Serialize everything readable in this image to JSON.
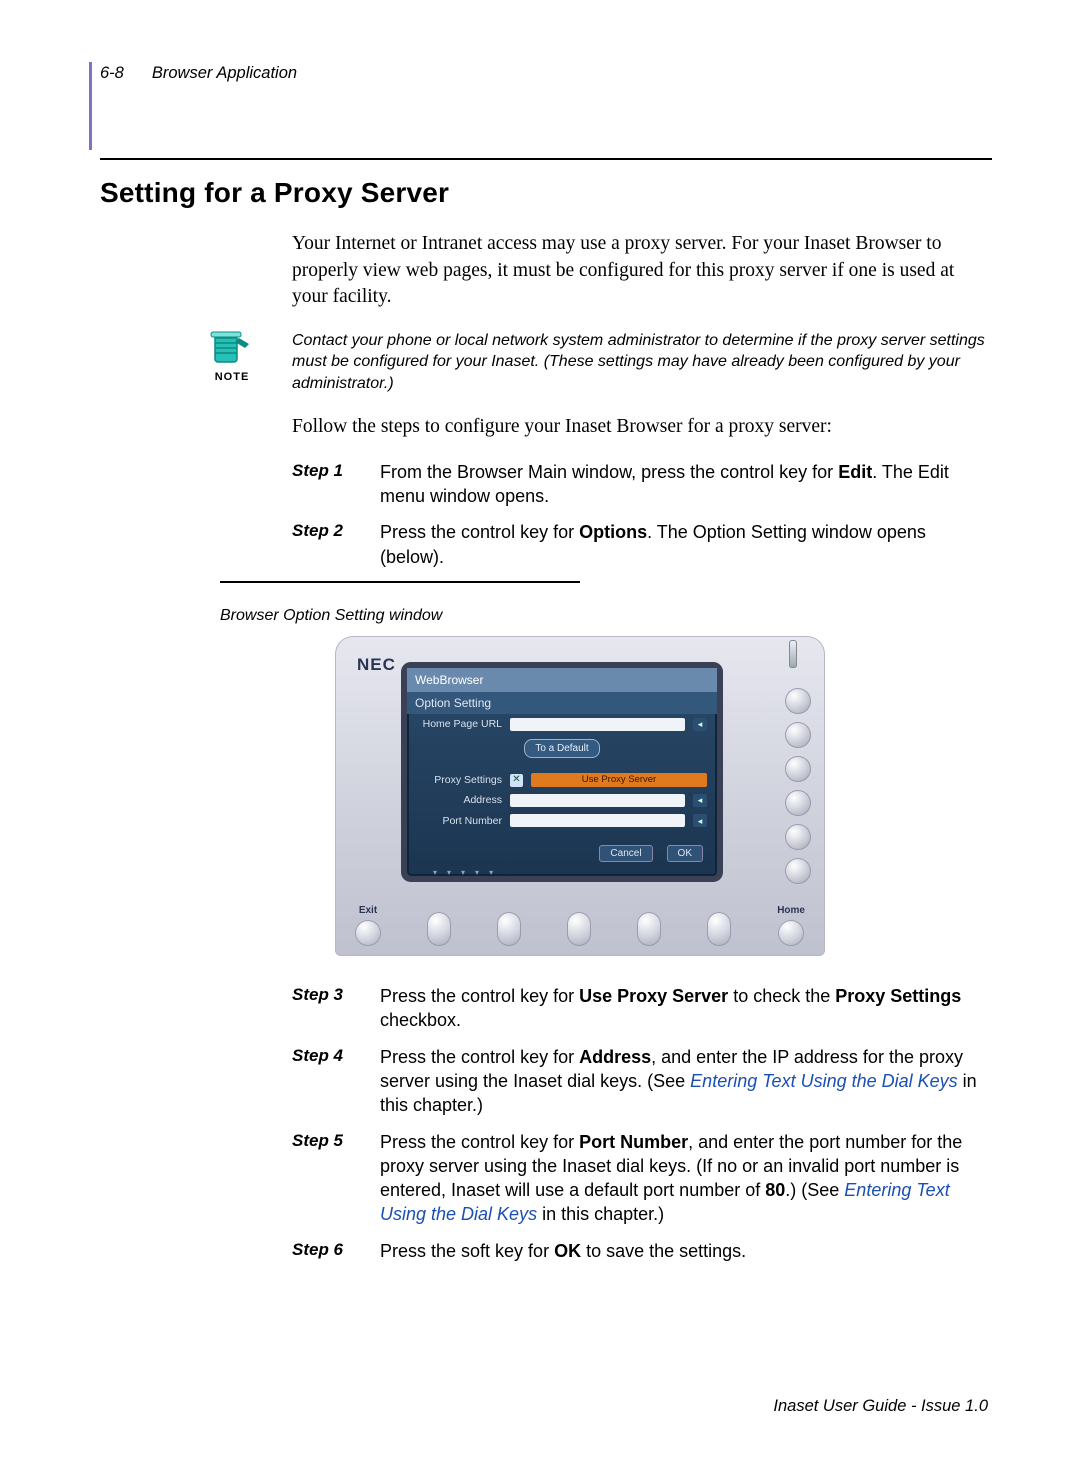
{
  "header": {
    "page_num": "6-8",
    "section": "Browser Application"
  },
  "title": "Setting for a Proxy Server",
  "intro": "Your Internet or Intranet access may use a proxy server. For your Inaset Browser to properly view web pages, it must be configured for this proxy server if one is used at your facility.",
  "note": {
    "label": "NOTE",
    "text": "Contact your phone or local network system administrator to determine if the proxy server settings must be configured for your Inaset. (These settings may have already been configured by your administrator.)"
  },
  "lead": "Follow the steps to configure your Inaset Browser for a proxy server:",
  "steps_top": [
    {
      "k": "Step  1",
      "pre": "From the Browser Main window, press the control key for ",
      "b": "Edit",
      "post": ". The Edit menu window opens."
    },
    {
      "k": "Step  2",
      "pre": "Press the control key for ",
      "b": "Options",
      "post": ". The Option Setting window opens (below)."
    }
  ],
  "figure": {
    "caption": "Browser Option Setting window",
    "nec": "NEC",
    "lcd": {
      "title": "WebBrowser",
      "subtitle": "Option Setting",
      "home_label": "Home Page URL",
      "to_default": "To a Default",
      "proxy_label": "Proxy Settings",
      "use_proxy": "Use Proxy Server",
      "address_label": "Address",
      "port_label": "Port Number",
      "cancel": "Cancel",
      "ok": "OK"
    },
    "hw": {
      "exit": "Exit",
      "home": "Home"
    }
  },
  "steps_bottom": [
    {
      "k": "Step  3",
      "pre": "Press the control key for ",
      "b1": "Use Proxy Server",
      "mid": " to check the ",
      "b2": "Proxy Settings",
      "post": " checkbox."
    },
    {
      "k": "Step  4",
      "pre": "Press the control key for ",
      "b1": "Address",
      "mid": ", and enter the IP address for the proxy server using the Inaset dial keys. (See ",
      "link": "Entering Text Using the Dial Keys",
      "post": " in this chapter.)"
    },
    {
      "k": "Step  5",
      "pre": "Press the control key for ",
      "b1": "Port Number",
      "mid": ", and enter the port number for the proxy server using the Inaset dial keys. (If no or an invalid port number is entered, Inaset will use a default port number of ",
      "b2": "80",
      "mid2": ".) (See ",
      "link": "Entering Text Using the Dial Keys",
      "post": " in this chapter.)"
    },
    {
      "k": "Step  6",
      "pre": "Press the soft key for ",
      "b1": "OK",
      "post": " to save the settings."
    }
  ],
  "footer": "Inaset User Guide - Issue 1.0"
}
